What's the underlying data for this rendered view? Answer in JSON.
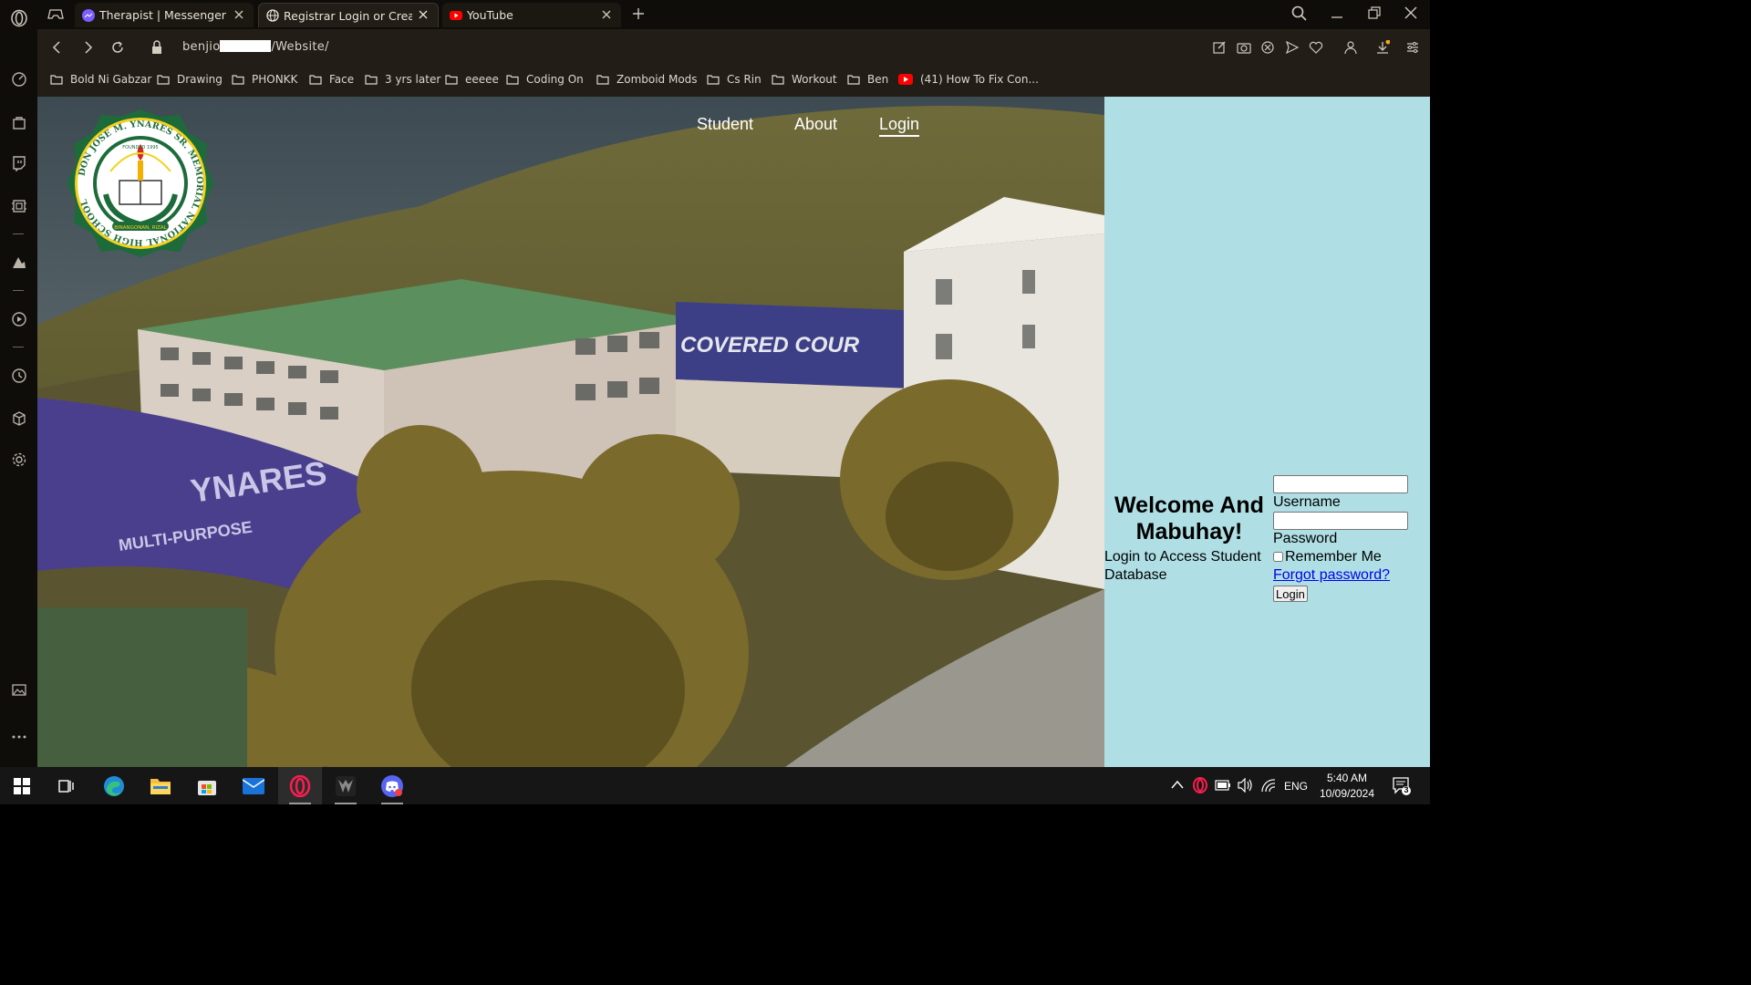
{
  "browser": {
    "tabs": [
      {
        "title": "Therapist | Messenger",
        "icon": "messenger-icon",
        "active": false
      },
      {
        "title": "Registrar Login or Create A",
        "icon": "globe-icon",
        "active": true
      },
      {
        "title": "YouTube",
        "icon": "youtube-icon",
        "active": false
      }
    ],
    "url_prefix": "benjio",
    "url_suffix": "/Website/",
    "bookmarks": [
      {
        "label": "Bold Ni Gabzar",
        "icon": "folder-icon"
      },
      {
        "label": "Drawing",
        "icon": "folder-icon"
      },
      {
        "label": "PHONKK",
        "icon": "folder-icon"
      },
      {
        "label": "Face",
        "icon": "folder-icon"
      },
      {
        "label": "3 yrs later",
        "icon": "folder-icon"
      },
      {
        "label": "eeeee",
        "icon": "folder-icon"
      },
      {
        "label": "Coding On",
        "icon": "folder-icon"
      },
      {
        "label": "Zomboid Mods",
        "icon": "folder-icon"
      },
      {
        "label": "Cs Rin",
        "icon": "folder-icon"
      },
      {
        "label": "Workout",
        "icon": "folder-icon"
      },
      {
        "label": "Ben",
        "icon": "folder-icon"
      },
      {
        "label": "(41) How To Fix Con...",
        "icon": "youtube-icon"
      }
    ]
  },
  "site": {
    "nav": [
      "Student",
      "About",
      "Login"
    ],
    "active_nav": "Login",
    "seal": {
      "ring_text": "DON JOSE M. YNARES SR. MEMORIAL NATIONAL HIGH SCHOOL",
      "founded": "FOUNDED 1995",
      "place": "BINANGONAN, RIZAL"
    },
    "hero_signs": {
      "building": "COVERED COUR",
      "dome_top": "YNARES",
      "dome_bottom": "MULTI-PURPOSE"
    },
    "welcome_title": "Welcome And Mabuhay!",
    "welcome_sub": "Login to Access Student Database",
    "form": {
      "username_label": "Username",
      "password_label": "Password",
      "username_value": "",
      "password_value": "",
      "remember_label": "Remember Me",
      "remember_checked": false,
      "forgot_label": "Forgot password?",
      "submit_label": "Login"
    },
    "sidebar_bg": "#afdfe4"
  },
  "taskbar": {
    "apps": [
      "windows-start-icon",
      "task-view-icon",
      "edge-icon",
      "file-explorer-icon",
      "microsoft-store-icon",
      "mail-icon",
      "opera-icon",
      "game-launcher-icon",
      "discord-icon"
    ],
    "tray": {
      "language": "ENG",
      "time": "5:40 AM",
      "date": "10/09/2024",
      "notifications": "3"
    }
  }
}
